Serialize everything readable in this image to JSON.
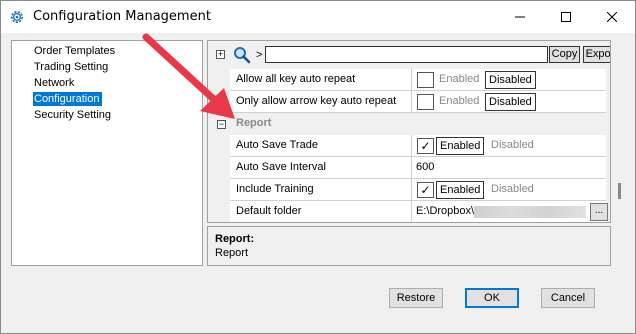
{
  "window": {
    "title": "Configuration Management"
  },
  "nav": {
    "items": [
      {
        "label": "Order Templates"
      },
      {
        "label": "Trading Setting"
      },
      {
        "label": "Network"
      },
      {
        "label": "Configuration",
        "selected": true
      },
      {
        "label": "Security Setting"
      }
    ]
  },
  "toolbar": {
    "gt_label": ">",
    "search_value": "",
    "copy_label": "Copy",
    "export_label": "Export"
  },
  "properties": {
    "rows_top": [
      {
        "name": "Allow all key auto repeat",
        "checked": false,
        "enabled_label": "Enabled",
        "disabled_label": "Disabled",
        "selected": "Disabled"
      },
      {
        "name": "Only allow arrow key auto repeat",
        "checked": false,
        "enabled_label": "Enabled",
        "disabled_label": "Disabled",
        "selected": "Disabled"
      }
    ],
    "category": {
      "label": "Report",
      "expander": "−"
    },
    "report_rows": [
      {
        "name": "Auto Save Trade",
        "checked": true,
        "enabled_label": "Enabled",
        "disabled_label": "Disabled",
        "selected": "Enabled"
      },
      {
        "name": "Auto Save Interval",
        "value": "600"
      },
      {
        "name": "Include Training",
        "checked": true,
        "enabled_label": "Enabled",
        "disabled_label": "Disabled",
        "selected": "Enabled"
      },
      {
        "name": "Default folder",
        "value": "E:\\Dropbox\\",
        "browse_label": "..."
      }
    ]
  },
  "description": {
    "title": "Report:",
    "text": "Report"
  },
  "buttons": {
    "restore": "Restore",
    "ok": "OK",
    "cancel": "Cancel"
  },
  "colors": {
    "selection": "#0078d7",
    "arrow": "#e8384a"
  },
  "icons": [
    "gear-icon",
    "search-icon",
    "minimize-icon",
    "maximize-icon",
    "close-icon",
    "expand-icon",
    "collapse-icon",
    "checkmark-icon",
    "arrow-annotation"
  ]
}
